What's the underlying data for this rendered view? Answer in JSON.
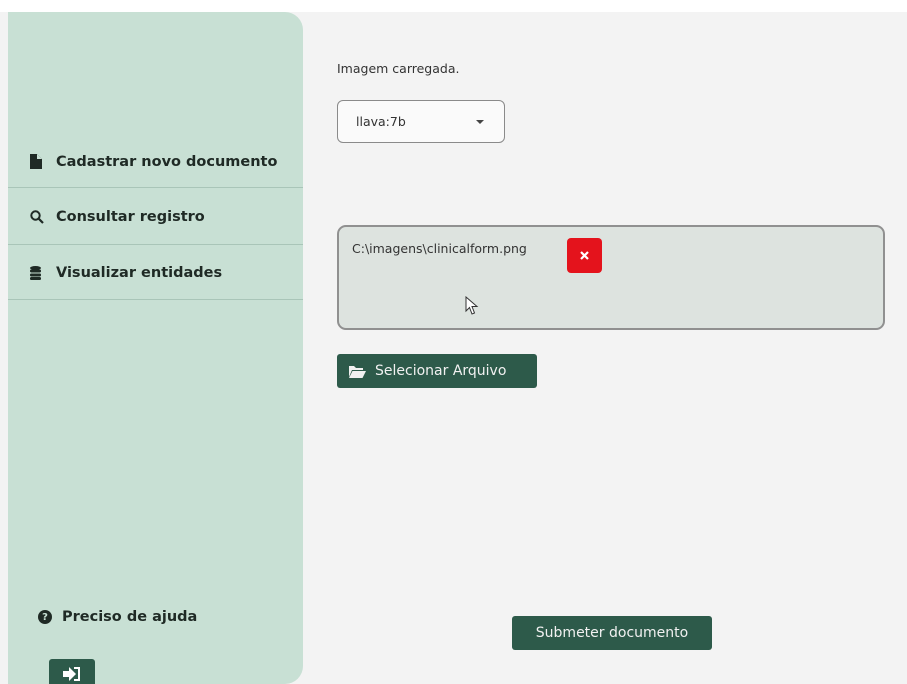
{
  "sidebar": {
    "items": [
      {
        "label": "Cadastrar novo documento",
        "icon": "file-icon"
      },
      {
        "label": "Consultar registro",
        "icon": "search-icon"
      },
      {
        "label": "Visualizar entidades",
        "icon": "database-icon"
      }
    ],
    "help_label": "Preciso de ajuda",
    "help_icon": "question-circle-icon",
    "logout_icon": "sign-out-icon"
  },
  "main": {
    "status_text": "Imagem carregada.",
    "model_select": {
      "value": "llava:7b"
    },
    "file_upload": {
      "path": "C:\\imagens\\clinicalform.png",
      "remove_icon": "close-icon"
    },
    "select_file_button": {
      "label": "Selecionar Arquivo",
      "icon": "folder-open-icon"
    },
    "submit_button": {
      "label": "Submeter documento"
    }
  },
  "colors": {
    "sidebar_bg": "#c8e0d4",
    "primary": "#2d5a4a",
    "danger": "#e4131c",
    "page_bg": "#f3f3f3"
  }
}
